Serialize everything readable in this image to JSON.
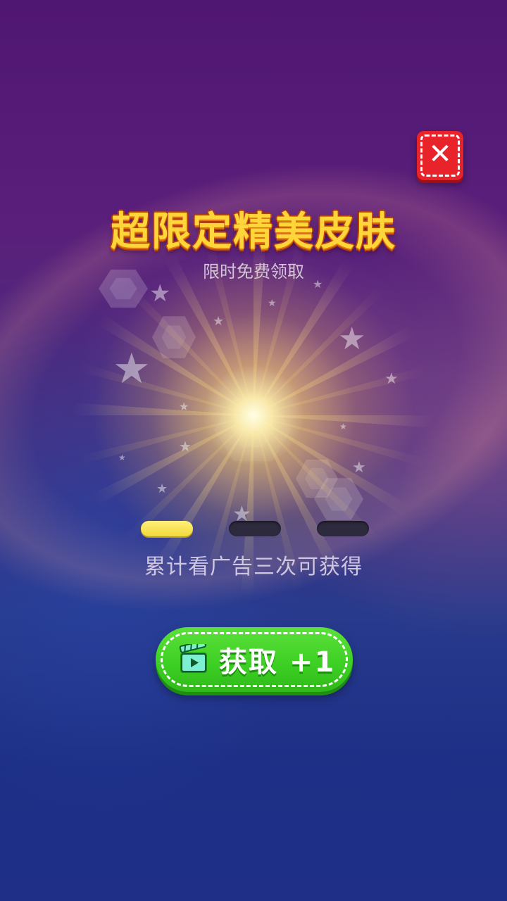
{
  "title": "超限定精美皮肤",
  "subtitle": "限时免费领取",
  "progress": {
    "completed": 1,
    "total": 3
  },
  "hint": "累计看广告三次可获得",
  "get_button": {
    "label": "获取 +1",
    "icon": "video-clapper-icon"
  },
  "close_button": {
    "icon": "close-icon"
  },
  "colors": {
    "progress_filled": "#f2d93a",
    "progress_empty": "#2e2a3e",
    "button_green": "#3ccf23",
    "close_red": "#e8232a",
    "title_gold": "#ffd63a"
  }
}
